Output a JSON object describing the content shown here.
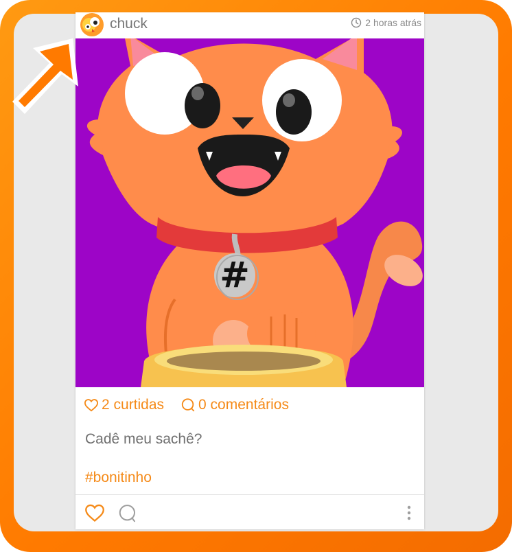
{
  "post": {
    "username": "chuck",
    "time_ago": "2 horas atrás",
    "likes_label": "2 curtidas",
    "comments_label": "0 comentários",
    "caption": "Cadê meu sachê?",
    "hashtag": "#bonitinho"
  },
  "photo": {
    "tag_symbol": "#"
  },
  "icons": {
    "avatar": "cat-avatar-icon",
    "clock": "clock-icon",
    "like_stat": "heart-outline-icon",
    "comment_stat": "speech-bubble-icon",
    "like_action": "heart-outline-icon",
    "comment_action": "speech-bubble-icon",
    "more": "more-vertical-icon",
    "pointer": "arrow-icon"
  },
  "colors": {
    "frame": "#ff8000",
    "accent": "#f58a18",
    "photo_background": "#9d05c7",
    "cat": "#ff8c4b"
  }
}
